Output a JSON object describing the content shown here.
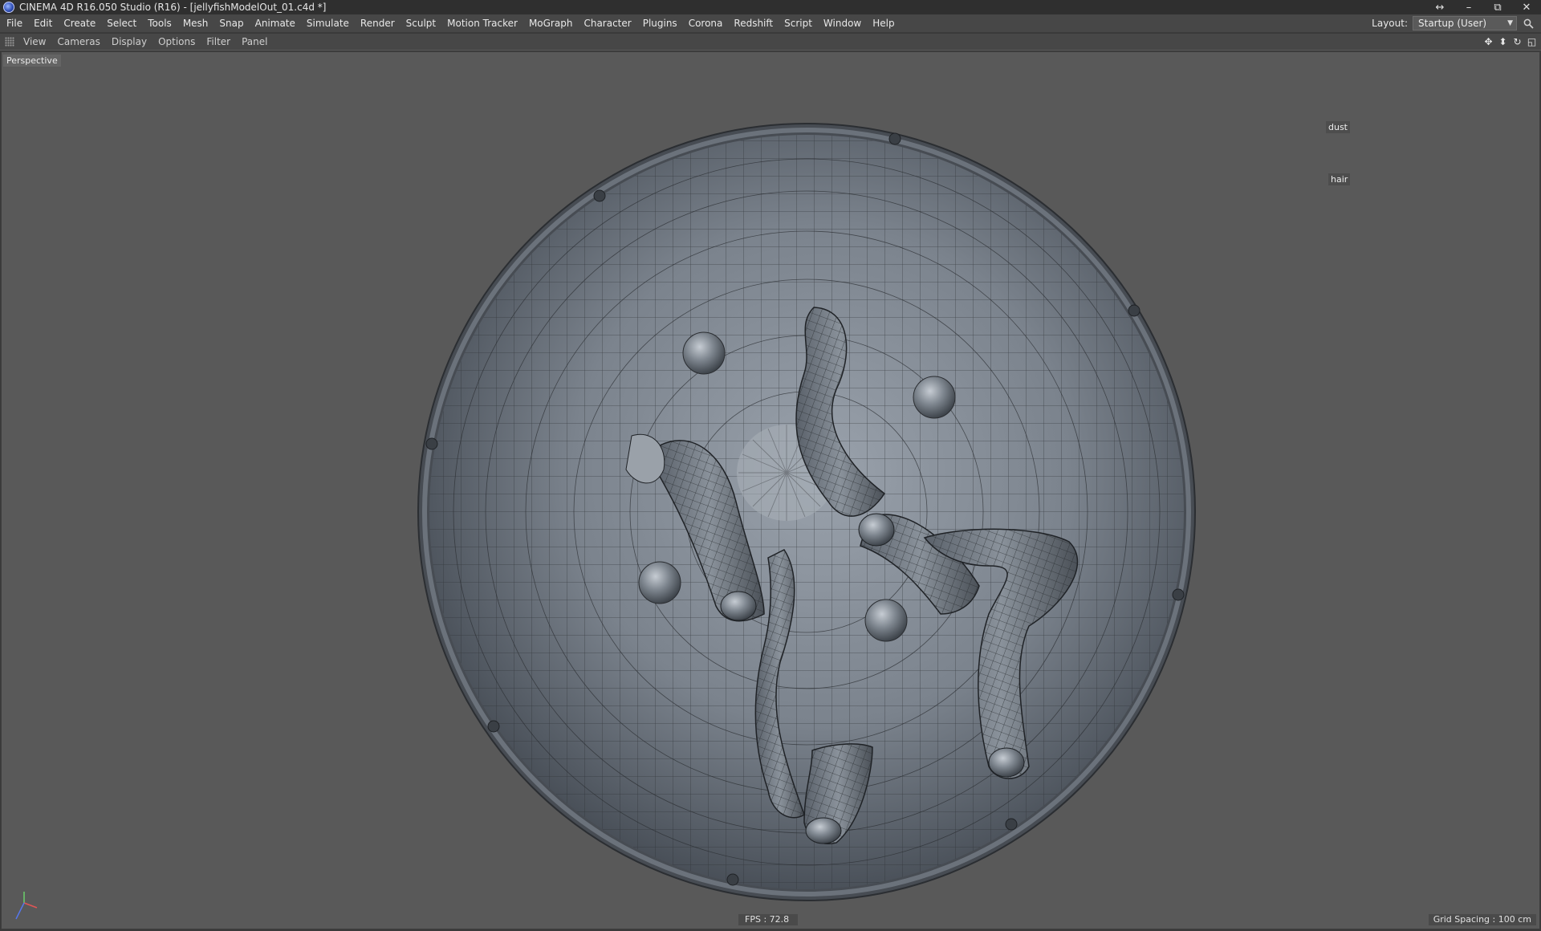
{
  "window": {
    "title": "CINEMA 4D R16.050 Studio (R16) - [jellyfishModelOut_01.c4d *]",
    "controls": {
      "resize": "↔",
      "minimize": "–",
      "restore": "⧉",
      "close": "✕"
    }
  },
  "menu": {
    "items": [
      "File",
      "Edit",
      "Create",
      "Select",
      "Tools",
      "Mesh",
      "Snap",
      "Animate",
      "Simulate",
      "Render",
      "Sculpt",
      "Motion Tracker",
      "MoGraph",
      "Character",
      "Plugins",
      "Corona",
      "Redshift",
      "Script",
      "Window",
      "Help"
    ],
    "layout_label": "Layout:",
    "layout_value": "Startup (User)"
  },
  "viewport_menu": {
    "items": [
      "View",
      "Cameras",
      "Display",
      "Options",
      "Filter",
      "Panel"
    ]
  },
  "viewport": {
    "camera_label": "Perspective",
    "object_labels": [
      "dust",
      "hair"
    ],
    "fps": "FPS : 72.8",
    "grid_spacing": "Grid Spacing : 100 cm"
  },
  "colors": {
    "viewport_bg": "#595959",
    "mesh_shade": "#8e96a0",
    "wire": "#2a2d31"
  }
}
